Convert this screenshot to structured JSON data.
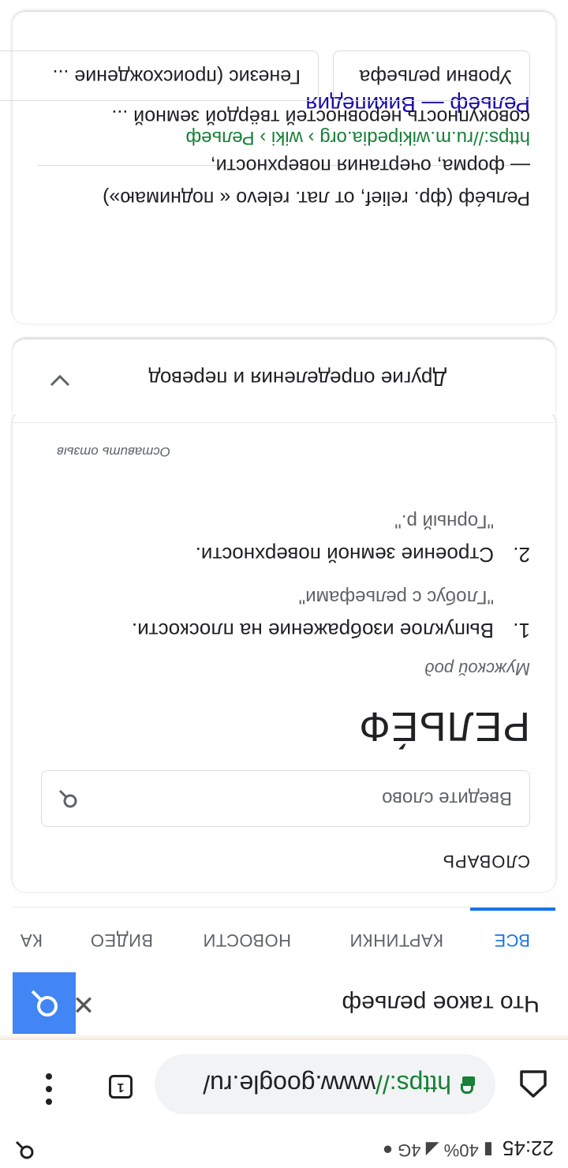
{
  "status_bar": {
    "time": "22:45",
    "battery": "40%",
    "network": "4G",
    "right_icon": "search-icon"
  },
  "chrome": {
    "url_scheme": "https://",
    "url_host": "www.google.ru/",
    "tabs_icon": "tab-switcher-icon",
    "menu_icon": "more-vert-icon",
    "home_icon": "home-icon"
  },
  "search": {
    "query": "Что такое рельеф",
    "clear_symbol": "✕",
    "tabs": [
      "ВСЕ",
      "КАРТИНКИ",
      "НОВОСТИ",
      "ВИДЕО",
      "КА"
    ]
  },
  "dictionary": {
    "heading": "СЛОВАРЬ",
    "input_placeholder": "Введите слово",
    "word": "РЕЛЬЕ́Ф",
    "part_of_speech": "Мужской род",
    "definitions": [
      {
        "num": "1.",
        "text": "Выпуклое изображение на плоскости.",
        "example": "\"Глобус с рельефами\""
      },
      {
        "num": "2.",
        "text": "Строение земной поверхности.",
        "example": "\"Горный р.\""
      }
    ],
    "feedback": "Оставить отзыв",
    "other_label": "Другие определения и перевод"
  },
  "wiki": {
    "title": "Рельеф — Википедия",
    "cite": "https://ru.m.wikipedia.org › wiki › Рельеф",
    "snippet_line1": "Релье́ф (фр. relief, от лат. relevo « поднимаю»)",
    "snippet_line2": "— форма, очертания поверхности,",
    "snippet_line3": "совокупность неровностей твёрдой земной ...",
    "chips": [
      "Уровни рельефа",
      "Генезис (происхождение ..."
    ]
  }
}
